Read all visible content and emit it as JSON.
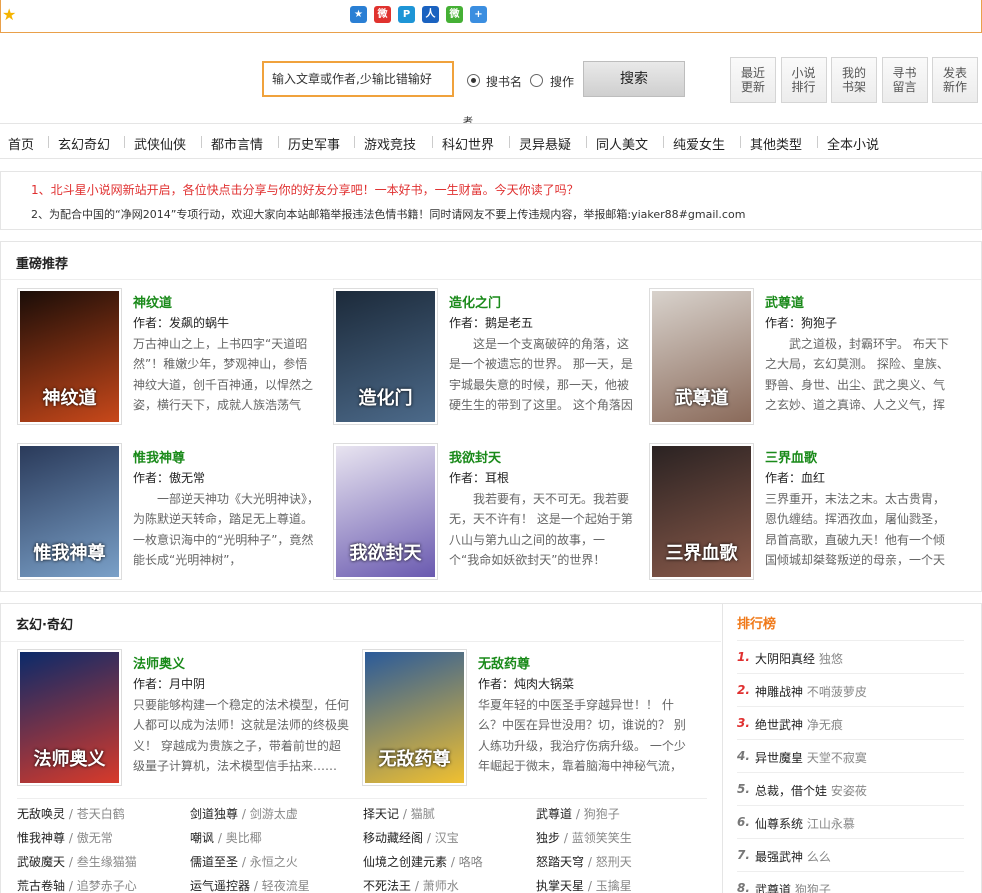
{
  "share_icons": [
    {
      "icon": "qzone-icon",
      "color": "#2a7fd4",
      "glyph": "★"
    },
    {
      "icon": "weibo-icon",
      "color": "#e0322e",
      "glyph": "微"
    },
    {
      "icon": "tencent-weibo-icon",
      "color": "#1e95d6",
      "glyph": "P"
    },
    {
      "icon": "renren-icon",
      "color": "#1a62c0",
      "glyph": "人"
    },
    {
      "icon": "wechat-icon",
      "color": "#45b035",
      "glyph": "微"
    },
    {
      "icon": "more-share-icon",
      "color": "#3b8ee0",
      "glyph": "+"
    }
  ],
  "search": {
    "value": "输入文章或作者,少输比错输好",
    "option_book": "搜书名",
    "option_author": "搜作",
    "button": "搜索",
    "note": "者"
  },
  "quick_links": [
    "最近\n更新",
    "小说\n排行",
    "我的\n书架",
    "寻书\n留言",
    "发表\n新作"
  ],
  "nav": [
    "首页",
    "玄幻奇幻",
    "武侠仙侠",
    "都市言情",
    "历史军事",
    "游戏竞技",
    "科幻世界",
    "灵异悬疑",
    "同人美文",
    "纯爱女生",
    "其他类型",
    "全本小说"
  ],
  "notices": [
    {
      "num": "1、",
      "text": "北斗星小说网新站开启，各位快点击分享与你的好友分享吧！一本好书，一生财富。今天你读了吗？"
    },
    {
      "num": "2、",
      "text": "为配合中国的“净网2014”专项行动，欢迎大家向本站邮箱举报违法色情书籍！同时请网友不要上传违规内容，举报邮箱:yiaker88#gmail.com"
    }
  ],
  "featured": {
    "title": "重磅推荐",
    "books": [
      {
        "title": "神纹道",
        "author": "作者：发飙的蜗牛",
        "intro": "万古神山之上，上书四字“天道昭然”！稚嫩少年，梦观神山，参悟神纹大道，创千百神通，以悍然之姿，横行天下，成就人族浩荡气",
        "cover_text": "神纹道",
        "cover_colors": [
          "#1a0d08",
          "#c8481a"
        ]
      },
      {
        "title": "造化之门",
        "author": "作者：鹅是老五",
        "intro": "　　这是一个支离破碎的角落，这是一个被遗忘的世界。 那一天，是宇城最失意的时候，那一天，他被硬生生的带到了这里。 这个角落因",
        "cover_text": "造化门",
        "cover_colors": [
          "#1c2a3a",
          "#4c6a8a"
        ]
      },
      {
        "title": "武尊道",
        "author": "作者：狗狍子",
        "intro": "　　武之道极，封霸环宇。 布天下之大局，玄幻莫测。 探险、皇族、野兽、身世、出尘、武之奥义、气之玄妙、道之真谛、人之义气，挥",
        "cover_text": "武尊道",
        "cover_colors": [
          "#d8d2cc",
          "#8a6a5a"
        ]
      },
      {
        "title": "惟我神尊",
        "author": "作者：傲无常",
        "intro": "　　一部逆天神功《大光明神诀》，为陈默逆天转命，踏足无上尊道。 一枚意识海中的“光明种子”，竟然能长成“光明神树”，",
        "cover_text": "惟我神尊",
        "cover_colors": [
          "#2a3a5a",
          "#7aa0c8"
        ]
      },
      {
        "title": "我欲封天",
        "author": "作者：耳根",
        "intro": "　　我若要有，天不可无。我若要无，天不许有！ 这是一个起始于第八山与第九山之间的故事，一个“我命如妖欲封天”的世界！",
        "cover_text": "我欲封天",
        "cover_colors": [
          "#e8e4f0",
          "#6a5ab0"
        ]
      },
      {
        "title": "三界血歌",
        "author": "作者：血红",
        "intro": "三界重开，末法之末。太古贵胄，恩仇缠结。挥洒孜血，屠仙戮圣，昂首高歌，直破九天！他有一个倾国倾城却桀骜叛逆的母亲，一个天",
        "cover_text": "三界血歌",
        "cover_colors": [
          "#2a2222",
          "#8a5a4a"
        ]
      }
    ]
  },
  "fantasy": {
    "title": "玄幻·奇幻",
    "books": [
      {
        "title": "法师奥义",
        "author": "作者：月中阴",
        "intro": "只要能够构建一个稳定的法术模型，任何人都可以成为法师！这就是法师的终极奥义！ 穿越成为贵族之子，带着前世的超级量子计算机，法术模型信手拈来…… ...",
        "cover_text": "法师奥义",
        "cover_colors": [
          "#0a2a6a",
          "#d83a2a"
        ]
      },
      {
        "title": "无敌药尊",
        "author": "作者：炖肉大锅菜",
        "intro": "华夏年轻的中医圣手穿越异世！！ 什么？中医在异世没用？切，谁说的？ 别人练功升级，我治疗伤病升级。 一个少年崛起于微末，靠着脑海中神秘气流， ...",
        "cover_text": "无敌药尊",
        "cover_colors": [
          "#2a5a9a",
          "#f0c030"
        ]
      }
    ],
    "list": [
      [
        "无敌唤灵",
        "苍天白鹤"
      ],
      [
        "剑道独尊",
        "剑游太虚"
      ],
      [
        "择天记",
        "猫腻"
      ],
      [
        "武尊道",
        "狗狍子"
      ],
      [
        "惟我神尊",
        "傲无常"
      ],
      [
        "嘲讽",
        "奥比椰"
      ],
      [
        "移动藏经阁",
        "汉宝"
      ],
      [
        "独步",
        "蓝领笑笑生"
      ],
      [
        "武破魔天",
        "叁生缘猫猫"
      ],
      [
        "儒道至圣",
        "永恒之火"
      ],
      [
        "仙境之创建元素",
        "咯咯"
      ],
      [
        "怒踏天穹",
        "怒刑天"
      ],
      [
        "荒古卷轴",
        "追梦赤子心"
      ],
      [
        "运气遥控器",
        "轻夜流星"
      ],
      [
        "不死法王",
        "萧师水"
      ],
      [
        "执掌天星",
        "玉擒星"
      ]
    ]
  },
  "ranking": {
    "title": "排行榜",
    "items": [
      {
        "num": "1.",
        "title": "大阴阳真经",
        "author": "独悠"
      },
      {
        "num": "2.",
        "title": "神雕战神",
        "author": "不哨菠萝皮"
      },
      {
        "num": "3.",
        "title": "绝世武神",
        "author": "净无痕"
      },
      {
        "num": "4.",
        "title": "异世魔皇",
        "author": "天堂不寂寞"
      },
      {
        "num": "5.",
        "title": "总裁，借个娃",
        "author": "安姿莜"
      },
      {
        "num": "6.",
        "title": "仙尊系统",
        "author": "江山永慕"
      },
      {
        "num": "7.",
        "title": "最强武神",
        "author": "么么"
      },
      {
        "num": "8.",
        "title": "武尊道",
        "author": "狗狍子"
      }
    ]
  },
  "colors": {
    "accent": "#f0a23c",
    "red": "#e03030",
    "green": "#1a8a1a",
    "rank_orange": "#f07a1a"
  }
}
